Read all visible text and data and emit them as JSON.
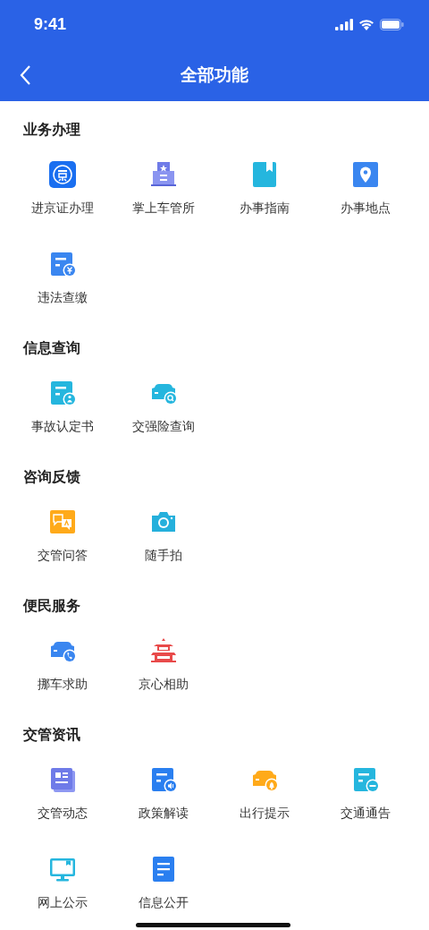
{
  "status_bar": {
    "time": "9:41"
  },
  "nav": {
    "title": "全部功能"
  },
  "sections": [
    {
      "title": "业务办理",
      "items": [
        {
          "label": "进京证办理"
        },
        {
          "label": "掌上车管所"
        },
        {
          "label": "办事指南"
        },
        {
          "label": "办事地点"
        },
        {
          "label": "违法查缴"
        }
      ]
    },
    {
      "title": "信息查询",
      "items": [
        {
          "label": "事故认定书"
        },
        {
          "label": "交强险查询"
        }
      ]
    },
    {
      "title": "咨询反馈",
      "items": [
        {
          "label": "交管问答"
        },
        {
          "label": "随手拍"
        }
      ]
    },
    {
      "title": "便民服务",
      "items": [
        {
          "label": "挪车求助"
        },
        {
          "label": "京心相助"
        }
      ]
    },
    {
      "title": "交管资讯",
      "items": [
        {
          "label": "交管动态"
        },
        {
          "label": "政策解读"
        },
        {
          "label": "出行提示"
        },
        {
          "label": "交通通告"
        },
        {
          "label": "网上公示"
        },
        {
          "label": "信息公开"
        }
      ]
    }
  ]
}
